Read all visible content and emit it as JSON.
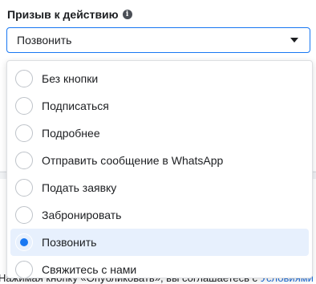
{
  "field": {
    "label": "Призыв к действию",
    "info_icon_glyph": "i",
    "selected_value": "Позвонить"
  },
  "dropdown": {
    "options": [
      {
        "label": "Без кнопки",
        "selected": false
      },
      {
        "label": "Подписаться",
        "selected": false
      },
      {
        "label": "Подробнее",
        "selected": false
      },
      {
        "label": "Отправить сообщение в WhatsApp",
        "selected": false
      },
      {
        "label": "Подать заявку",
        "selected": false
      },
      {
        "label": "Забронировать",
        "selected": false
      },
      {
        "label": "Позвонить",
        "selected": true
      },
      {
        "label": "Свяжитесь с нами",
        "selected": false
      }
    ]
  },
  "footer": {
    "text": "Нажимая кнопку «Опубликовать», вы соглашаетесь с ",
    "link": "Условиями"
  },
  "colors": {
    "accent": "#1877f2",
    "selected_bg": "#e7f0fd",
    "text": "#1c1e21",
    "border": "#dddfe2"
  }
}
